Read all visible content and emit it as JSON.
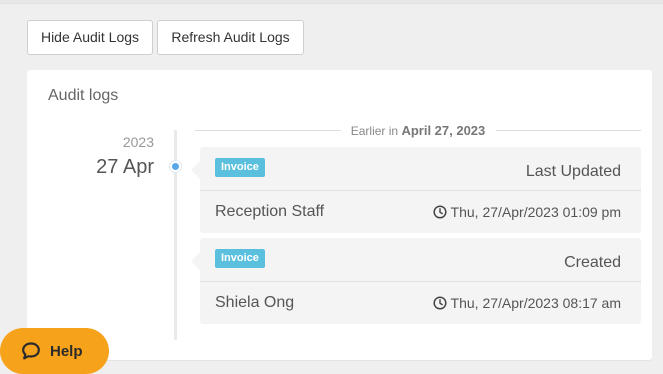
{
  "toolbar": {
    "hide_label": "Hide Audit Logs",
    "refresh_label": "Refresh Audit Logs"
  },
  "panel": {
    "title": "Audit logs",
    "date_year": "2023",
    "date_day": "27 Apr",
    "separator_prefix": "Earlier in",
    "separator_date": "April 27, 2023",
    "entries": [
      {
        "badge": "Invoice",
        "action": "Last Updated",
        "user": "Reception Staff",
        "timestamp": "Thu, 27/Apr/2023 01:09 pm"
      },
      {
        "badge": "Invoice",
        "action": "Created",
        "user": "Shiela Ong",
        "timestamp": "Thu, 27/Apr/2023 08:17 am"
      }
    ]
  },
  "help": {
    "label": "Help"
  },
  "colors": {
    "badge": "#5bc0de",
    "timeline_dot": "#5aa7e6",
    "help_button": "#f7a21b"
  },
  "icons": {
    "clock": "clock-icon",
    "chat": "chat-bubble-icon"
  }
}
